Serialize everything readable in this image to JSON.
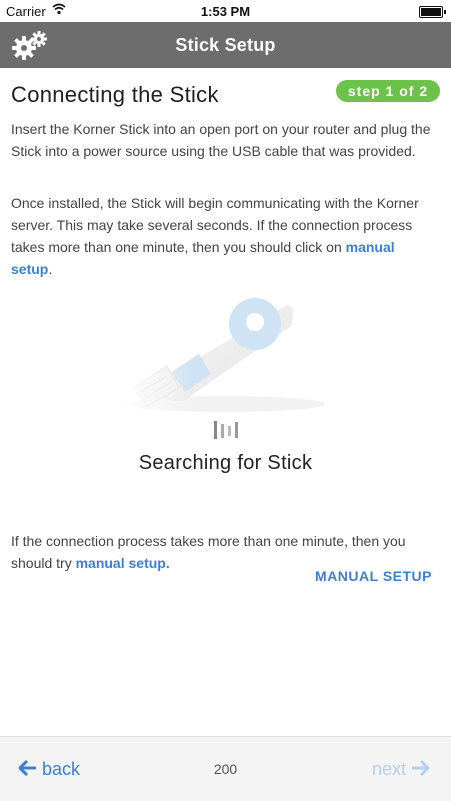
{
  "status_bar": {
    "carrier": "Carrier",
    "time": "1:53 PM"
  },
  "nav": {
    "title": "Stick Setup",
    "icon": "gear-icon"
  },
  "heading": "Connecting the Stick",
  "step_badge": "step 1 of 2",
  "paragraph1": "Insert the Korner Stick into an open port on your router and plug the Stick into a power source using the USB cable that was provided.",
  "paragraph2_text": "Once installed, the Stick will begin communicating with the Korner server. This may take several seconds. If the connection process takes more than one minute, then you should click on ",
  "paragraph2_link": "manual setup",
  "paragraph2_end": ".",
  "searching_text": "Searching for Stick",
  "paragraph3_text": "If the connection process takes more than one minute, then you should try ",
  "paragraph3_link": "manual setup.",
  "manual_setup_button": "MANUAL SETUP",
  "footer": {
    "back_label": "back",
    "page_number": "200",
    "next_label": "next"
  },
  "colors": {
    "accent": "#3d7fd4",
    "badge": "#6cc24a",
    "navbar": "#6d6d6d",
    "next_disabled": "#b8cfee"
  }
}
